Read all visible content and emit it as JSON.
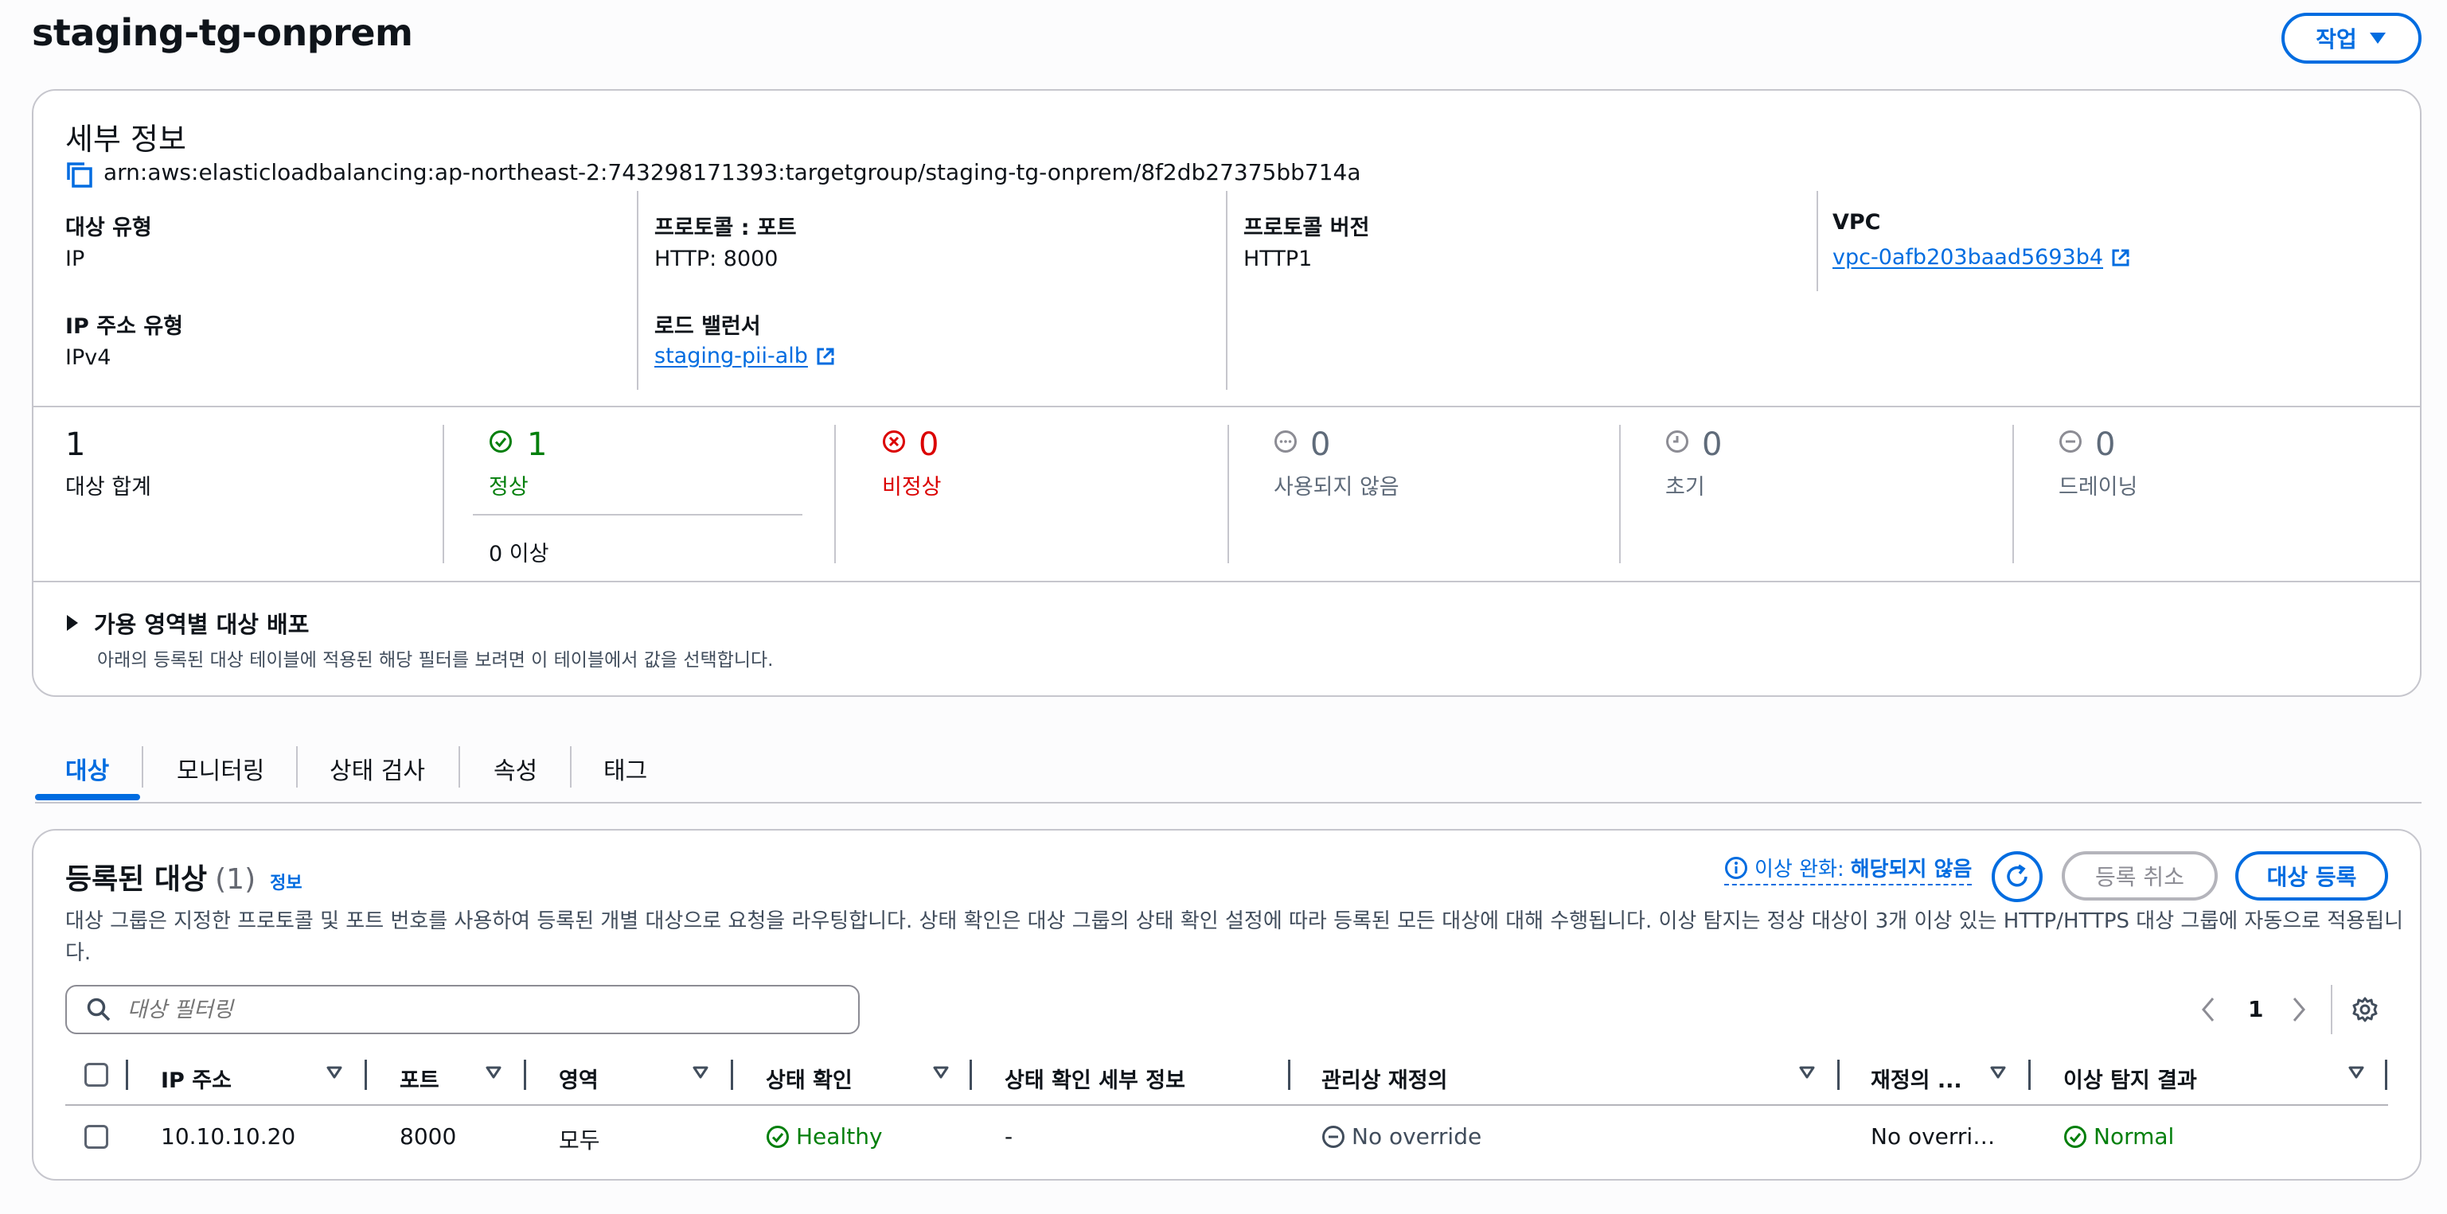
{
  "page": {
    "title": "staging-tg-onprem",
    "actions_label": "작업"
  },
  "details": {
    "heading": "세부 정보",
    "arn": "arn:aws:elasticloadbalancing:ap-northeast-2:743298171393:targetgroup/staging-tg-onprem/8f2db27375bb714a",
    "target_type_label": "대상 유형",
    "target_type_value": "IP",
    "ip_type_label": "IP 주소 유형",
    "ip_type_value": "IPv4",
    "protocol_port_label": "프로토콜 : 포트",
    "protocol_port_value": "HTTP: 8000",
    "load_balancer_label": "로드 밸런서",
    "load_balancer_value": "staging-pii-alb",
    "protocol_version_label": "프로토콜 버전",
    "protocol_version_value": "HTTP1",
    "vpc_label": "VPC",
    "vpc_value": "vpc-0afb203baad5693b4"
  },
  "stats": {
    "total": {
      "value": "1",
      "label": "대상 합계"
    },
    "healthy": {
      "value": "1",
      "label": "정상",
      "anomaly": "0 이상"
    },
    "unhealthy": {
      "value": "0",
      "label": "비정상"
    },
    "unused": {
      "value": "0",
      "label": "사용되지 않음"
    },
    "initial": {
      "value": "0",
      "label": "초기"
    },
    "draining": {
      "value": "0",
      "label": "드레이닝"
    }
  },
  "az": {
    "heading": "가용 영역별 대상 배포",
    "description": "아래의 등록된 대상 테이블에 적용된 해당 필터를 보려면 이 테이블에서 값을 선택합니다."
  },
  "tabs": [
    {
      "label": "대상"
    },
    {
      "label": "모니터링"
    },
    {
      "label": "상태 검사"
    },
    {
      "label": "속성"
    },
    {
      "label": "태그"
    }
  ],
  "registered": {
    "title": "등록된 대상",
    "count": "(1)",
    "info": "정보",
    "mitigation_prefix": "이상 완화:",
    "mitigation_value": "해당되지 않음",
    "deregister_label": "등록 취소",
    "register_label": "대상 등록",
    "description": "대상 그룹은 지정한 프로토콜 및 포트 번호를 사용하여 등록된 개별 대상으로 요청을 라우팅합니다. 상태 확인은 대상 그룹의 상태 확인 설정에 따라 등록된 모든 대상에 대해 수행됩니다. 이상 탐지는 정상 대상이 3개 이상 있는 HTTP/HTTPS 대상 그룹에 자동으로 적용됩니다.",
    "filter_placeholder": "대상 필터링",
    "page_number": "1",
    "columns": [
      "IP 주소",
      "포트",
      "영역",
      "상태 확인",
      "상태 확인 세부 정보",
      "관리상 재정의",
      "재정의 ...",
      "이상 탐지 결과"
    ],
    "rows": [
      {
        "ip": "10.10.10.20",
        "port": "8000",
        "zone": "모두",
        "health": "Healthy",
        "health_detail": "-",
        "override": "No override",
        "override_detail": "No overri…",
        "anomaly": "Normal"
      }
    ]
  },
  "colors": {
    "link": "#006ce0",
    "healthy": "#037f0c",
    "unhealthy": "#db0000",
    "muted": "#656871",
    "border": "#c6c6cd"
  }
}
